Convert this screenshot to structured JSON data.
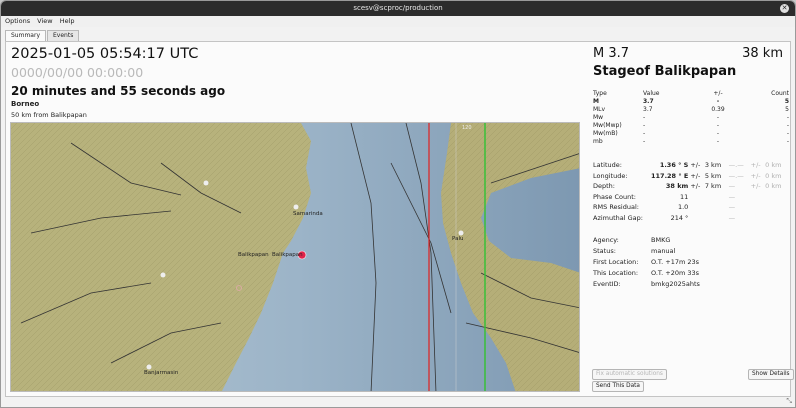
{
  "window": {
    "title": "scesv@scproc/production",
    "close_glyph": "✕"
  },
  "menu": [
    "Options",
    "View",
    "Help"
  ],
  "tabs": [
    "Summary",
    "Events"
  ],
  "summary": {
    "datetime": "2025-01-05 05:54:17 UTC",
    "datetime_placeholder": "0000/00/00  00:00:00",
    "time_ago": "20 minutes and 55 seconds ago",
    "region": "Borneo",
    "distance_text": "50 km from Balikpapan"
  },
  "map": {
    "labels": {
      "samarinda": "Samarinda",
      "balikpapan": "Balikpapan",
      "balikpapan2": "Balikpapan",
      "palu": "Palu",
      "banjarmasin": "Banjarmasin",
      "grid": "120"
    },
    "colors": {
      "land": "#b7b27c",
      "sea_shallow": "#a9bfcf",
      "sea_deep": "#7f9ab3",
      "epicenter": "#e0244a",
      "meridian_red": "#e02020",
      "meridian_green": "#38c038"
    }
  },
  "event": {
    "magnitude": "M 3.7",
    "depth_big": "38 km",
    "place": "Stageof Balikpapan"
  },
  "mag_table": {
    "headers": [
      "Type",
      "Value",
      "+/-",
      "Count"
    ],
    "rows": [
      {
        "type": "M",
        "value": "3.7",
        "err": "-",
        "count": "5",
        "bold": true
      },
      {
        "type": "MLv",
        "value": "3.7",
        "err": "0.39",
        "count": "5",
        "bold": false
      },
      {
        "type": "Mw",
        "value": "-",
        "err": "-",
        "count": "-",
        "bold": false
      },
      {
        "type": "Mw(Mwp)",
        "value": "-",
        "err": "-",
        "count": "-",
        "bold": false
      },
      {
        "type": "Mw(mB)",
        "value": "-",
        "err": "-",
        "count": "-",
        "bold": false
      },
      {
        "type": "mb",
        "value": "-",
        "err": "-",
        "count": "-",
        "bold": false
      }
    ]
  },
  "location": {
    "latitude_label": "Latitude:",
    "latitude": "1.36 ° S",
    "latitude_pm": "+/-",
    "latitude_err": "3 km",
    "latitude_dim1": "—.—",
    "latitude_dim2": "+/-",
    "latitude_dim3": "0 km",
    "longitude_label": "Longitude:",
    "longitude": "117.28 ° E",
    "longitude_pm": "+/-",
    "longitude_err": "5 km",
    "longitude_dim1": "—.—",
    "longitude_dim2": "+/-",
    "longitude_dim3": "0 km",
    "depth_label": "Depth:",
    "depth": "38 km",
    "depth_pm": "+/-",
    "depth_err": "7 km",
    "depth_dim1": "—",
    "depth_dim2": "+/-",
    "depth_dim3": "0 km",
    "phase_label": "Phase Count:",
    "phase": "11",
    "phase_dim": "—",
    "rms_label": "RMS Residual:",
    "rms": "1.0",
    "rms_dim": "—",
    "gap_label": "Azimuthal Gap:",
    "gap": "214 °",
    "gap_dim": "—"
  },
  "agency": {
    "agency_label": "Agency:",
    "agency": "BMKG",
    "status_label": "Status:",
    "status": "manual",
    "first_label": "First Location:",
    "first": "O.T. +17m 23s",
    "this_label": "This Location:",
    "this": "O.T. +20m 33s",
    "eventid_label": "EventID:",
    "eventid": "bmkg2025ahts"
  },
  "buttons": {
    "fix": "Fix automatic solutions",
    "send": "Send This Data",
    "details": "Show Details"
  },
  "corner_glyph": "⤡"
}
